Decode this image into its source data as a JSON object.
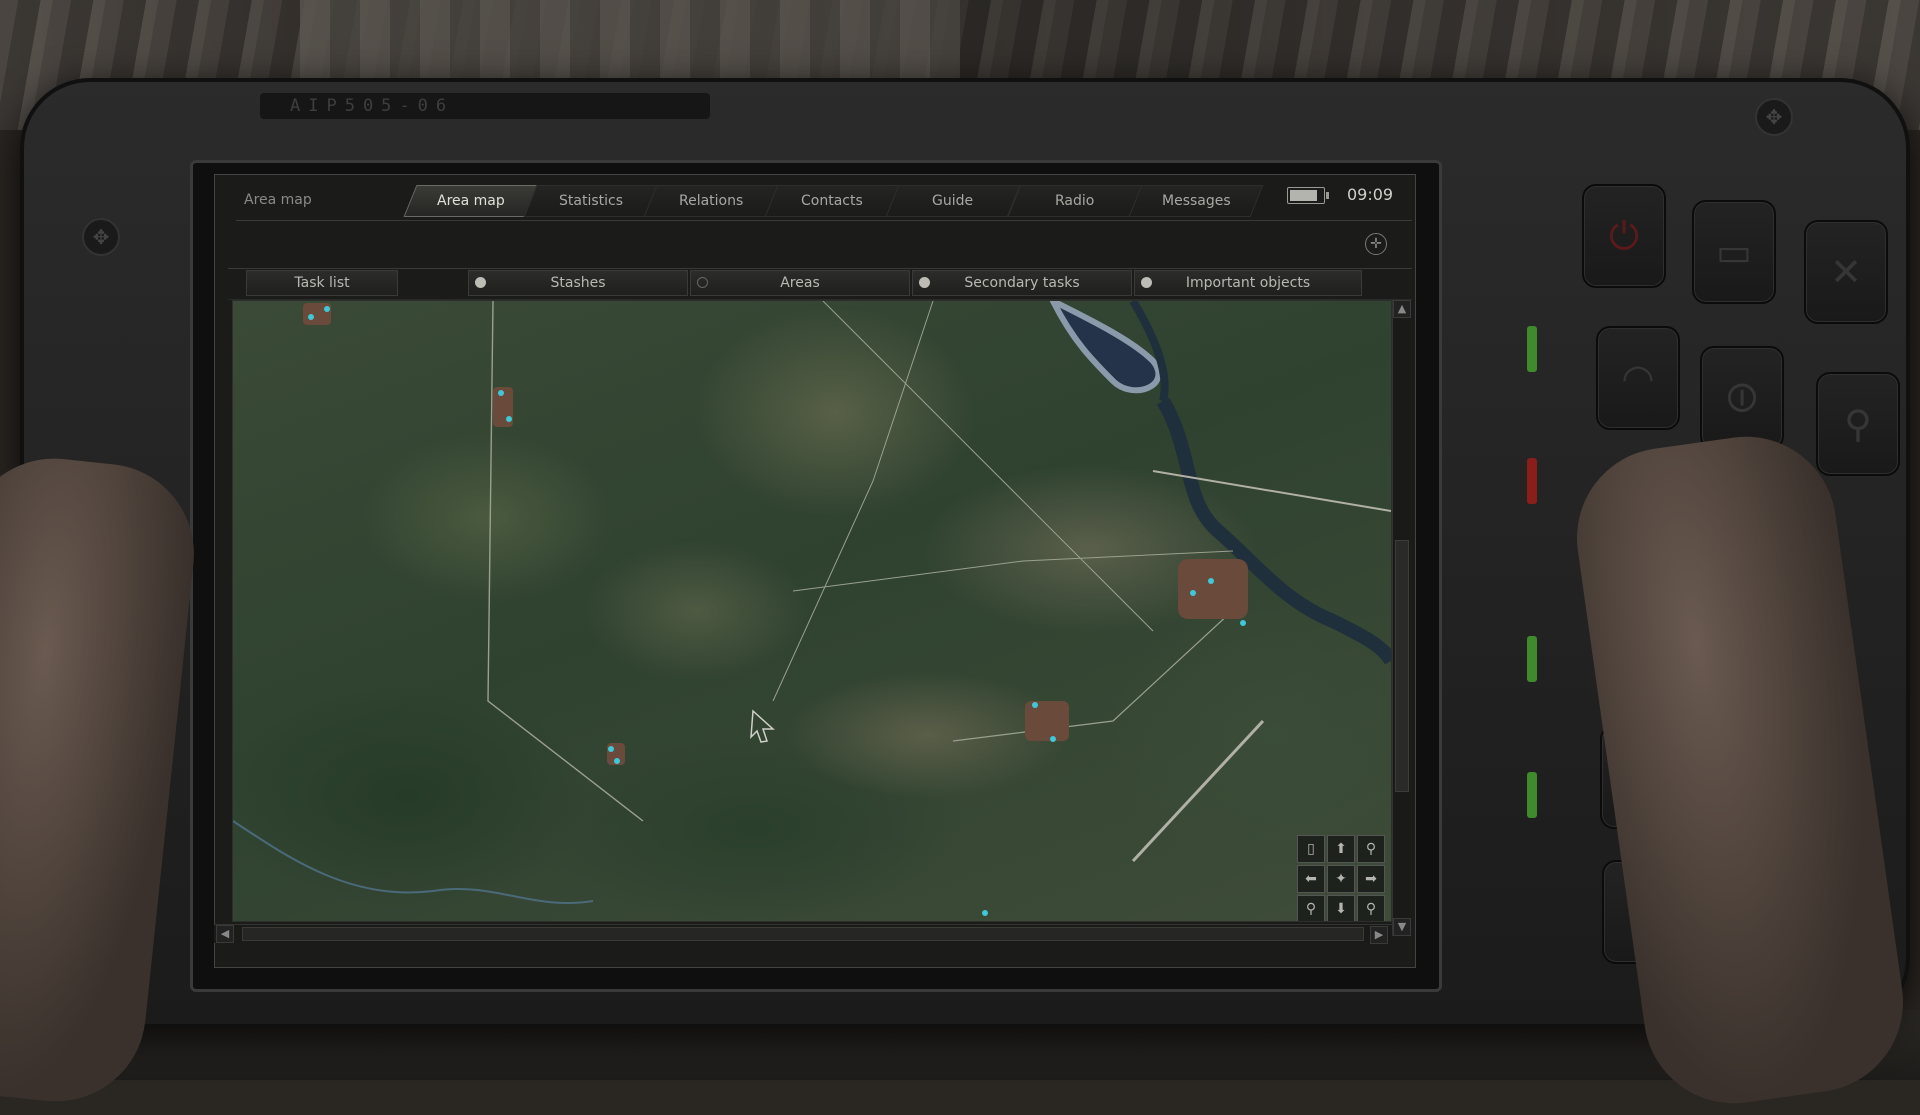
{
  "device": {
    "model": "ΑΙΡ505-06"
  },
  "header": {
    "title": "Area map",
    "clock": "09:09",
    "battery_level": 0.85
  },
  "tabs": [
    {
      "label": "Area map",
      "active": true
    },
    {
      "label": "Statistics",
      "active": false
    },
    {
      "label": "Relations",
      "active": false
    },
    {
      "label": "Contacts",
      "active": false
    },
    {
      "label": "Guide",
      "active": false
    },
    {
      "label": "Radio",
      "active": false
    },
    {
      "label": "Messages",
      "active": false
    }
  ],
  "filters": {
    "task_list": "Task list",
    "stashes": {
      "label": "Stashes",
      "on": true
    },
    "areas": {
      "label": "Areas",
      "on": false
    },
    "secondary_tasks": {
      "label": "Secondary tasks",
      "on": true
    },
    "important_objects": {
      "label": "Important objects",
      "on": true
    }
  },
  "map_controls": {
    "icons": [
      "note-icon",
      "arrow-up-icon",
      "zoom-in-icon",
      "arrow-left-icon",
      "player-center-icon",
      "arrow-right-icon",
      "zoom-out-icon",
      "arrow-down-icon",
      "zoom-reset-icon"
    ]
  },
  "colors": {
    "screen_text": "#b8b8b2",
    "active_tab": "#e0e0d8",
    "led_green": "#3f8a2a",
    "led_red": "#8a1f1a",
    "marker": "#3ec8d8"
  }
}
